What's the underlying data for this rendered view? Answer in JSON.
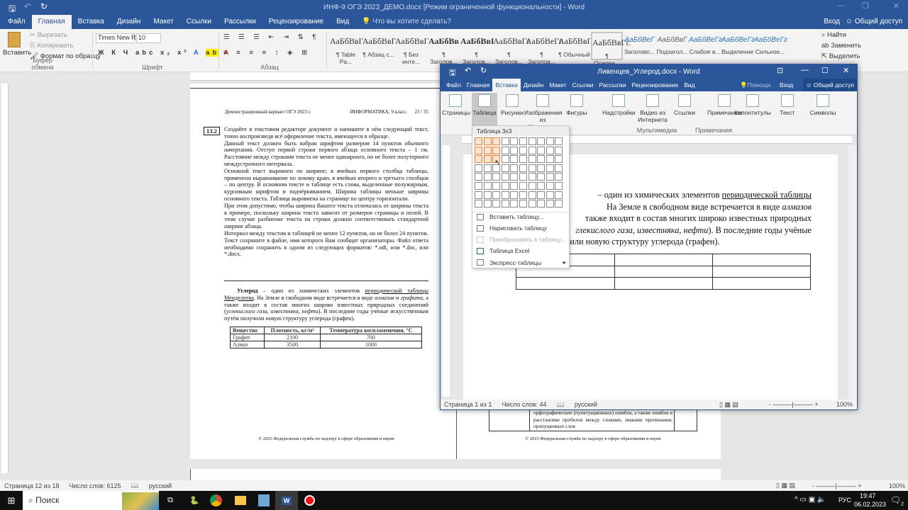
{
  "main_window": {
    "title": "ИНФ-9 ОГЭ 2023_ДЕМО.docx [Режим ограниченной функциональности] - Word",
    "tabs": [
      "Файл",
      "Главная",
      "Вставка",
      "Дизайн",
      "Макет",
      "Ссылки",
      "Рассылки",
      "Рецензирование",
      "Вид"
    ],
    "active_tab": "Главная",
    "tell_me": "Что вы хотите сделать?",
    "sign_in": "Вход",
    "share": "Общий доступ",
    "clipboard": {
      "paste": "Вставить",
      "cut": "Вырезать",
      "copy": "Копировать",
      "format_painter": "Формат по образцу",
      "group": "Буфер обмена"
    },
    "font": {
      "name": "Times New R",
      "size": "10",
      "group": "Шрифт"
    },
    "paragraph": {
      "group": "Абзац"
    },
    "styles": [
      {
        "preview": "АаБбВвГ",
        "name": "¶ Table Pa..."
      },
      {
        "preview": "АаБбВвГ",
        "name": "¶ Абзац с..."
      },
      {
        "preview": "АаБбВвГ",
        "name": "¶ Без инте..."
      },
      {
        "preview": "АаБбВв",
        "name": "¶ Заголов..."
      },
      {
        "preview": "АаБбВвІ",
        "name": "¶ Заголов..."
      },
      {
        "preview": "АаБбВвГг",
        "name": "¶ Заголов..."
      },
      {
        "preview": "АаБбВеГг",
        "name": "¶ Заголов..."
      },
      {
        "preview": "АаБбВвГ",
        "name": "¶ Обычный"
      },
      {
        "preview": "АаБбВвГг.",
        "name": "¶ Основн..."
      },
      {
        "preview": "АаБбВеГ",
        "name": "Заголово..."
      },
      {
        "preview": "АаБбВвГ",
        "name": "Подзагол..."
      },
      {
        "preview": "АаБбВеГг",
        "name": "Слабое в..."
      },
      {
        "preview": "АаБбВеГг",
        "name": "Выделение"
      },
      {
        "preview": "АаБбВеГг",
        "name": "Сильное..."
      }
    ],
    "editing": {
      "find": "Найти",
      "replace": "Заменить",
      "select": "Выделить"
    },
    "status": {
      "page": "Страница 12 из 18",
      "words": "Число слов: 6125",
      "lang": "русский",
      "zoom": "100%"
    }
  },
  "left_page": {
    "header_left": "Демонстрационный вариант ОГЭ 2023 г.",
    "header_right": "ИНФОРМАТИКА, 9 класс.",
    "page_num": "23 / 35",
    "task_num": "13.2",
    "task_text": [
      "Создайте в текстовом редакторе документ и напишите в нём следующий текст, точно воспроизведя всё оформление текста, имеющееся в образце.",
      "Данный текст должен быть набран шрифтом размером 14 пунктов обычного начертания. Отступ первой строки первого абзаца основного текста – 1 см. Расстояние между строками текста не менее одинарного, но не более полуторного междустрочного интервала.",
      "Основной текст выровнен по ширине; в ячейках первого столбца таблицы, применено выравнивание по левому краю, в ячейках второго и третьего столбцов – по центру. В основном тексте и таблице есть слова, выделенные полужирным, курсивным шрифтом и подчёркиванием. Ширина таблицы меньше ширины основного текста. Таблица выровнена на странице по центру горизонтали.",
      "При этом допустимо, чтобы ширина Вашего текста отличалась от ширины текста в примере, поскольку ширина текста зависит от размеров страницы и полей. В этом случае разбиение текста на строки должно соответствовать стандартной ширине абзаца.",
      "Интервал между текстом и таблицей не менее 12 пунктов, но не более 24 пунктов.",
      "Текст сохраните в файле, имя которого Вам сообщат организаторы. Файл ответа необходимо сохранить в одном из следующих форматов: *.odt, или *.doc, или *.docx."
    ],
    "sample": {
      "b": "Углерод",
      "t1": " – один из химических элементов ",
      "u": "периодической таблицы Менделеева",
      "t2": ". На Земле в свободном виде встречается в виде ",
      "i1": "алмазов",
      "t3": " и ",
      "i2": "графита",
      "t4": ", а также входит в состав многих широко известных природных соединений (",
      "i3": "углекислого газа, известняка, нефти",
      "t5": "). В последние годы учёные искусственным путём получили новую структуру углерода (графен)."
    },
    "table": {
      "headers": [
        "Вещество",
        "Плотность, кг/м³",
        "Температура воспламенения, °С"
      ],
      "rows": [
        [
          "Графит",
          "2100",
          "700"
        ],
        [
          "Алмаз",
          "3500",
          "1000"
        ]
      ]
    },
    "footer": "© 2023 Федеральная служба по надзору в сфере образования и науки"
  },
  "right_page": {
    "cell_text": "орфографических (пунктуационных) ошибок, а также ошибок в расстановке пробелов между словами, знаками препинания, пропущенных слов",
    "footer": "© 2023 Федеральная служба по надзору в сфере образования и науки"
  },
  "second_window": {
    "title": "Ливенцев_Углерод.docx - Word",
    "tabs": [
      "Файл",
      "Главная",
      "Вставка",
      "Дизайн",
      "Макет",
      "Ссылки",
      "Рассылки",
      "Рецензирование",
      "Вид"
    ],
    "active_tab": "Вставка",
    "help": "Помощн",
    "sign_in": "Вход",
    "share": "Общий доступ",
    "ribbon": [
      "Страницы",
      "Таблица",
      "Рисунки",
      "Изображения из Интернета",
      "Фигуры",
      "Надстройки",
      "Видео из Интернета",
      "Ссылки",
      "Примечание",
      "Колонтитулы",
      "Текст",
      "Символы"
    ],
    "groups": [
      "Мультимедиа",
      "Примечания"
    ],
    "doc_text": {
      "t1": "– один из химических элементов ",
      "u": "периодической таблицы",
      "l2": "На Земле в свободном виде встречается в виде ",
      "i1": "алмазов",
      "l3": "также входит в состав многих широко известных природных",
      "i2": "глекислого газа, известняка, нефти",
      "l4": "). В последние годы учёные",
      "l5": "м путём получили новую структуру углерода (графен)."
    },
    "status": {
      "page": "Страница 1 из 1",
      "words": "Число слов: 44",
      "lang": "русский",
      "zoom": "100%"
    }
  },
  "table_menu": {
    "title": "Таблица 3x3",
    "grid": {
      "cols": 10,
      "rows": 8,
      "selected_cols": 3,
      "selected_rows": 3
    },
    "items": [
      {
        "label": "Вставить таблицу...",
        "enabled": true
      },
      {
        "label": "Нарисовать таблицу",
        "enabled": true
      },
      {
        "label": "Преобразовать в таблицу...",
        "enabled": false
      },
      {
        "label": "Таблица Excel",
        "enabled": true
      },
      {
        "label": "Экспресс-таблицы",
        "enabled": true
      }
    ]
  },
  "taskbar": {
    "search": "Поиск",
    "lang": "РУС",
    "time": "19:47",
    "date": "06.02.2023",
    "notifications": "2"
  },
  "colors": {
    "word_blue": "#2b579a",
    "ribbon": "#f3f3f3",
    "grid_highlight": "#e8803a"
  }
}
